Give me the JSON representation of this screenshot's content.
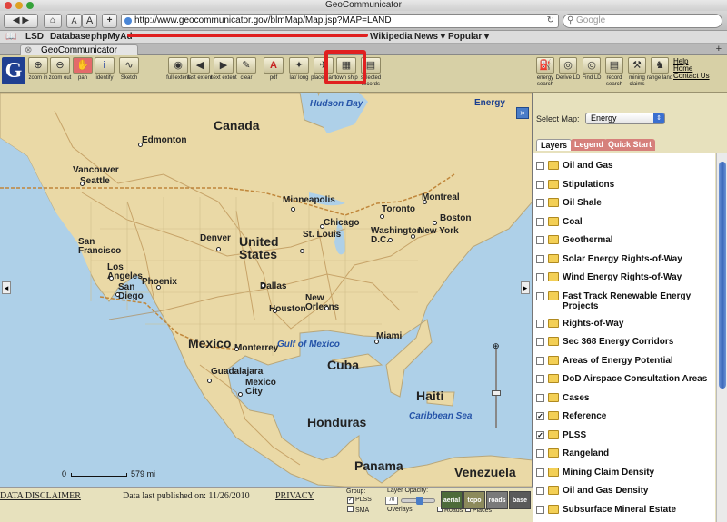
{
  "window": {
    "title": "GeoCommunicator"
  },
  "browser": {
    "url": "http://www.geocommunicator.gov/blmMap/Map.jsp?MAP=LAND",
    "search_placeholder": "Google",
    "font_small": "A",
    "font_large": "A",
    "add": "+",
    "bookmarks": [
      "LSD",
      "Database",
      "phpMyAd",
      "Wikipedia",
      "News ▾",
      "Popular ▾"
    ],
    "tab_title": "GeoCommunicator",
    "new_tab": "+"
  },
  "tools": [
    {
      "id": "zoom-in",
      "label": "zoom in",
      "glyph": "⊕"
    },
    {
      "id": "zoom-out",
      "label": "zoom out",
      "glyph": "⊖"
    },
    {
      "id": "pan",
      "label": "pan",
      "glyph": "✋"
    },
    {
      "id": "identify",
      "label": "identify",
      "glyph": "i"
    },
    {
      "id": "sketch",
      "label": "Sketch",
      "glyph": "∿"
    },
    {
      "id": "full-extent",
      "label": "full extent",
      "glyph": "◉"
    },
    {
      "id": "last-extent",
      "label": "last extent",
      "glyph": "◀"
    },
    {
      "id": "next-extent",
      "label": "next extent",
      "glyph": "▶"
    },
    {
      "id": "clear",
      "label": "clear",
      "glyph": "✎"
    },
    {
      "id": "pdf",
      "label": "pdf",
      "glyph": "A"
    },
    {
      "id": "lat-long",
      "label": "lat/ long",
      "glyph": "✦"
    },
    {
      "id": "place-name",
      "label": "place nam",
      "glyph": "✈"
    },
    {
      "id": "town-ship",
      "label": "town ship",
      "glyph": "▦"
    },
    {
      "id": "selected-records",
      "label": "selected records",
      "glyph": "▤"
    }
  ],
  "right_tools": [
    {
      "id": "energy-search",
      "label": "energy search",
      "glyph": "⛽"
    },
    {
      "id": "derive-ld",
      "label": "Derive LD",
      "glyph": "◎"
    },
    {
      "id": "find-ld",
      "label": "Find LD",
      "glyph": "◎"
    },
    {
      "id": "record-search",
      "label": "record search",
      "glyph": "▤"
    },
    {
      "id": "mining-claims",
      "label": "mining claims",
      "glyph": "⚒"
    },
    {
      "id": "range-land",
      "label": "range land",
      "glyph": "♞"
    }
  ],
  "help_links": [
    "Help",
    "Home",
    "Contact Us"
  ],
  "map": {
    "title": "Energy",
    "scale": "579 mi",
    "scale_zero": "0",
    "collapse": "»",
    "pan_west": "◂",
    "pan_east": "▸",
    "labels": [
      {
        "text": "Hudson Bay",
        "cls": "water"
      },
      {
        "text": "Canada",
        "cls": "country"
      },
      {
        "text": "Edmonton",
        "cls": "city"
      },
      {
        "text": "Vancouver",
        "cls": "city"
      },
      {
        "text": "Seattle",
        "cls": "city"
      },
      {
        "text": "Minneapolis",
        "cls": "city"
      },
      {
        "text": "Montreal",
        "cls": "city"
      },
      {
        "text": "Toronto",
        "cls": "city"
      },
      {
        "text": "Boston",
        "cls": "city"
      },
      {
        "text": "Chicago",
        "cls": "city"
      },
      {
        "text": "New York",
        "cls": "city"
      },
      {
        "text": "Washington D.C.",
        "cls": "city"
      },
      {
        "text": "Denver",
        "cls": "city"
      },
      {
        "text": "United States",
        "cls": "country"
      },
      {
        "text": "St. Louis",
        "cls": "city"
      },
      {
        "text": "San Francisco",
        "cls": "city"
      },
      {
        "text": "Los Angeles",
        "cls": "city"
      },
      {
        "text": "San Diego",
        "cls": "city"
      },
      {
        "text": "Phoenix",
        "cls": "city"
      },
      {
        "text": "Dallas",
        "cls": "city"
      },
      {
        "text": "Houston",
        "cls": "city"
      },
      {
        "text": "New Orleans",
        "cls": "city"
      },
      {
        "text": "Miami",
        "cls": "city"
      },
      {
        "text": "Gulf of Mexico",
        "cls": "water"
      },
      {
        "text": "Mexico",
        "cls": "country"
      },
      {
        "text": "Monterrey",
        "cls": "city"
      },
      {
        "text": "Guadalajara",
        "cls": "city"
      },
      {
        "text": "Mexico City",
        "cls": "city"
      },
      {
        "text": "Cuba",
        "cls": "country"
      },
      {
        "text": "Haiti",
        "cls": "country"
      },
      {
        "text": "Caribbean Sea",
        "cls": "water"
      },
      {
        "text": "Honduras",
        "cls": "country"
      },
      {
        "text": "Panama",
        "cls": "country"
      },
      {
        "text": "Venezuela",
        "cls": "country"
      }
    ]
  },
  "side": {
    "select_label": "Select Map:",
    "select_value": "Energy",
    "tabs": [
      "Layers",
      "Legend",
      "Quick Start"
    ],
    "layers": [
      {
        "name": "Oil and Gas",
        "checked": false
      },
      {
        "name": "Stipulations",
        "checked": false
      },
      {
        "name": "Oil Shale",
        "checked": false
      },
      {
        "name": "Coal",
        "checked": false
      },
      {
        "name": "Geothermal",
        "checked": false
      },
      {
        "name": "Solar Energy Rights-of-Way",
        "checked": false
      },
      {
        "name": "Wind Energy Rights-of-Way",
        "checked": false
      },
      {
        "name": "Fast Track Renewable Energy",
        "name2": "Projects",
        "checked": false
      },
      {
        "name": "Rights-of-Way",
        "checked": false
      },
      {
        "name": "Sec 368 Energy Corridors",
        "checked": false
      },
      {
        "name": "Areas of Energy Potential",
        "checked": false
      },
      {
        "name": "DoD Airspace Consultation Areas",
        "checked": false
      },
      {
        "name": "Cases",
        "checked": false
      },
      {
        "name": "Reference",
        "checked": true
      },
      {
        "name": "PLSS",
        "checked": true
      },
      {
        "name": "Rangeland",
        "checked": false
      },
      {
        "name": "Mining Claim Density",
        "checked": false
      },
      {
        "name": "Oil and Gas Density",
        "checked": false
      },
      {
        "name": "Subsurface Mineral Estate",
        "checked": false
      }
    ]
  },
  "footer": {
    "disclaimer": "DATA DISCLAIMER",
    "published": "Data last published on: 11/26/2010",
    "privacy": "PRIVACY",
    "group_label": "Group:",
    "plss": "PLSS",
    "sma": "SMA",
    "opacity_label": "Layer Opacity:",
    "opacity_value": "70",
    "overlays_label": "Overlays:",
    "roads": "Roads",
    "places": "Places",
    "base_buttons": [
      "aerial",
      "topo",
      "roads",
      "base"
    ]
  },
  "colors": {
    "panel": "#e7e1bd",
    "highlight": "#e02020",
    "water": "#aed0e8",
    "land": "#ead9a6"
  }
}
